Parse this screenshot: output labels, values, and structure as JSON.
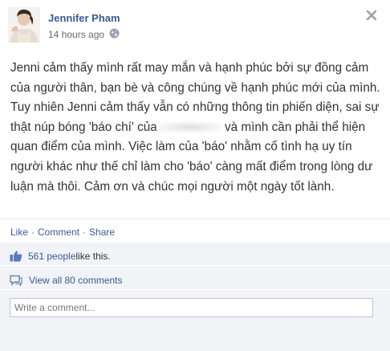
{
  "post": {
    "author": "Jennifer Pham",
    "timestamp": "14 hours ago",
    "privacy_icon": "globe-icon",
    "text_parts": [
      "Jenni cảm thấy mình rất may mắn và hạnh phúc bởi sự đồng cảm của người thân, bạn bè và công chúng về hạnh phúc mới của mình. Tuy nhiên Jenni cảm thấy vẫn có những thông tin phiến diện, sai sự thật núp bóng 'báo chí' của",
      " và mình cần phải thể hiện quan điểm của mình. Việc làm của 'báo' nhằm cố tình hạ uy tín người khác như thế chỉ làm cho 'báo' càng mất điểm trong lòng dư luận mà thôi. Cảm ơn và chúc mọi người một ngày tốt lành."
    ]
  },
  "actions": {
    "like": "Like",
    "comment": "Comment",
    "share": "Share",
    "separator": "·"
  },
  "feedback": {
    "likes_link": "561 people",
    "likes_suffix": " like this.",
    "view_comments": "View all 80 comments",
    "comment_placeholder": "Write a comment..."
  },
  "colors": {
    "link": "#3b5998",
    "text": "#333333",
    "feedback_bg": "#f2f3f6"
  }
}
